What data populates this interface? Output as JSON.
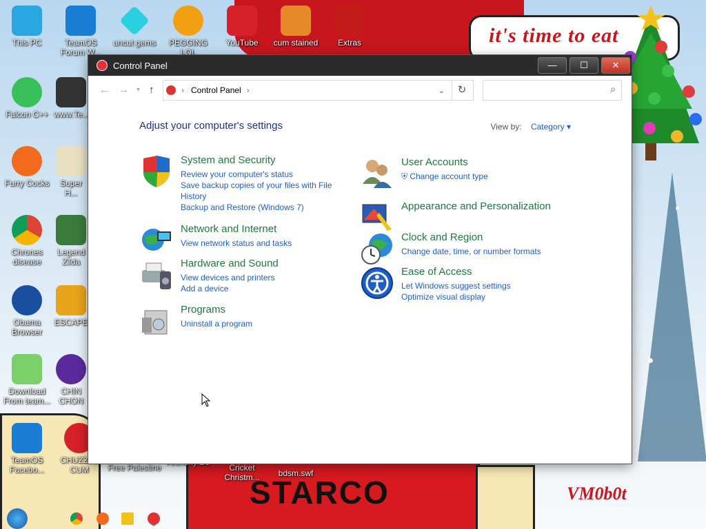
{
  "wallpaper": {
    "sign_text": "it's time to eat",
    "banner_text": "STARCO",
    "signature": "VM0b0t"
  },
  "desktop_icons": [
    {
      "label": "This PC"
    },
    {
      "label": "TeamOS Forum W..."
    },
    {
      "label": "uncut gems"
    },
    {
      "label": "PEGGING LOL"
    },
    {
      "label": "YouTube"
    },
    {
      "label": "cum stained"
    },
    {
      "label": "Extras"
    },
    {
      "label": "Falcon C++"
    },
    {
      "label": "www.Te..."
    },
    {
      "label": "Furry Cocks"
    },
    {
      "label": "Super H..."
    },
    {
      "label": "Chrones disease"
    },
    {
      "label": "Legend Zilda"
    },
    {
      "label": "Obama Browser"
    },
    {
      "label": "ESCAPE"
    },
    {
      "label": "Download From team..."
    },
    {
      "label": "CHIN CHON"
    },
    {
      "label": "TeamOS Facebo..."
    },
    {
      "label": "CHUZZLE CUM"
    },
    {
      "label": "Free Palestine"
    },
    {
      "label": "Anthony Bo"
    },
    {
      "label": "Cricket Christm..."
    },
    {
      "label": "bdsm.swf"
    }
  ],
  "window": {
    "title": "Control Panel",
    "minimize": "—",
    "maximize": "☐",
    "close": "✕",
    "address": {
      "path": "Control Panel",
      "separator": "›",
      "refresh": "↻",
      "search_placeholder": ""
    },
    "heading": "Adjust your computer's settings",
    "view_by_label": "View by:",
    "view_by_value": "Category"
  },
  "categories_left": [
    {
      "title": "System and Security",
      "links": [
        "Review your computer's status",
        "Save backup copies of your files with File History",
        "Backup and Restore (Windows 7)"
      ]
    },
    {
      "title": "Network and Internet",
      "links": [
        "View network status and tasks"
      ]
    },
    {
      "title": "Hardware and Sound",
      "links": [
        "View devices and printers",
        "Add a device"
      ]
    },
    {
      "title": "Programs",
      "links": [
        "Uninstall a program"
      ]
    }
  ],
  "categories_right": [
    {
      "title": "User Accounts",
      "links": [
        "Change account type"
      ]
    },
    {
      "title": "Appearance and Personalization",
      "links": []
    },
    {
      "title": "Clock and Region",
      "links": [
        "Change date, time, or number formats"
      ]
    },
    {
      "title": "Ease of Access",
      "links": [
        "Let Windows suggest settings",
        "Optimize visual display"
      ]
    }
  ]
}
